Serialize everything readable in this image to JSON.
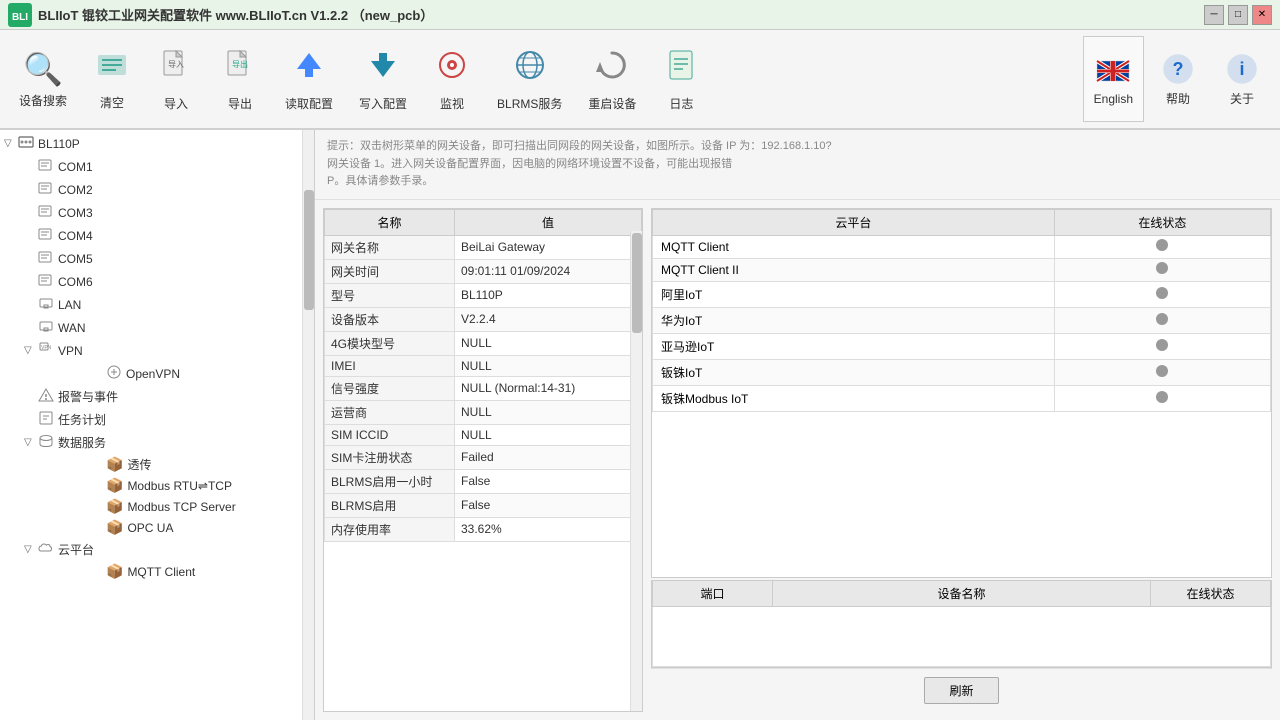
{
  "titlebar": {
    "title": "BLIIoT 锟铰工业网关配置软件 www.BLIIoT.cn V1.2.2 （new_pcb）",
    "controls": [
      "minimize",
      "maximize",
      "close"
    ]
  },
  "toolbar": {
    "buttons": [
      {
        "id": "search",
        "icon": "🔍",
        "label": "设备搜索"
      },
      {
        "id": "clear",
        "icon": "🧹",
        "label": "清空"
      },
      {
        "id": "import",
        "icon": "📥",
        "label": "导入"
      },
      {
        "id": "export",
        "icon": "📤",
        "label": "导出"
      },
      {
        "id": "read-config",
        "icon": "⬆️",
        "label": "读取配置"
      },
      {
        "id": "write-config",
        "icon": "⬇️",
        "label": "写入配置"
      },
      {
        "id": "monitor",
        "icon": "👁",
        "label": "监视"
      },
      {
        "id": "blrms",
        "icon": "🌐",
        "label": "BLRMS服务"
      },
      {
        "id": "restart",
        "icon": "⏻",
        "label": "重启设备"
      },
      {
        "id": "log",
        "icon": "📋",
        "label": "日志"
      }
    ],
    "english": "English",
    "help": "帮助",
    "about": "关于"
  },
  "sidebar": {
    "tree": [
      {
        "id": "bl110p",
        "label": "BL110P",
        "icon": "🖧",
        "expanded": true,
        "level": 0,
        "hasToggle": true
      },
      {
        "id": "com1",
        "label": "COM1",
        "icon": "⌨",
        "level": 1
      },
      {
        "id": "com2",
        "label": "COM2",
        "icon": "⌨",
        "level": 1
      },
      {
        "id": "com3",
        "label": "COM3",
        "icon": "⌨",
        "level": 1
      },
      {
        "id": "com4",
        "label": "COM4",
        "icon": "⌨",
        "level": 1
      },
      {
        "id": "com5",
        "label": "COM5",
        "icon": "⌨",
        "level": 1
      },
      {
        "id": "com6",
        "label": "COM6",
        "icon": "⌨",
        "level": 1
      },
      {
        "id": "lan",
        "label": "LAN",
        "icon": "🖥",
        "level": 1
      },
      {
        "id": "wan",
        "label": "WAN",
        "icon": "🖥",
        "level": 1
      },
      {
        "id": "vpn",
        "label": "VPN",
        "icon": "🔒",
        "level": 1,
        "expanded": true,
        "hasToggle": true
      },
      {
        "id": "openvpn",
        "label": "OpenVPN",
        "icon": "🔑",
        "level": 2
      },
      {
        "id": "alert",
        "label": "报警与事件",
        "icon": "🔔",
        "level": 1
      },
      {
        "id": "task",
        "label": "任务计划",
        "icon": "📅",
        "level": 1
      },
      {
        "id": "dataservice",
        "label": "数据服务",
        "icon": "🗄",
        "level": 1,
        "expanded": true,
        "hasToggle": true
      },
      {
        "id": "transmit",
        "label": "透传",
        "icon": "📦",
        "level": 2
      },
      {
        "id": "modbus-rtu-tcp",
        "label": "Modbus RTU⇌TCP",
        "icon": "📦",
        "level": 2
      },
      {
        "id": "modbus-tcp-server",
        "label": "Modbus TCP Server",
        "icon": "📦",
        "level": 2
      },
      {
        "id": "opc-ua",
        "label": "OPC UA",
        "icon": "📦",
        "level": 2
      },
      {
        "id": "cloudplatform",
        "label": "云平台",
        "icon": "☁",
        "level": 1,
        "expanded": true,
        "hasToggle": true
      },
      {
        "id": "mqtt-client",
        "label": "MQTT Client",
        "icon": "📦",
        "level": 2
      }
    ]
  },
  "content": {
    "header_lines": [
      "提示：双击树形菜单的网关设备，即可扫描出同网段的网关设备，如图所示。设备 IP 为：192.168.1.10?",
      "网关设备 1。进入网关设备配置界面，因电脑的网络环境设置不设备，可能出现报错",
      "P。具体请参数手录。"
    ]
  },
  "info_table": {
    "headers": [
      "名称",
      "值"
    ],
    "rows": [
      {
        "name": "网关名称",
        "value": "BeiLai Gateway"
      },
      {
        "name": "网关时间",
        "value": "09:01:11 01/09/2024"
      },
      {
        "name": "型号",
        "value": "BL110P"
      },
      {
        "name": "设备版本",
        "value": "V2.2.4"
      },
      {
        "name": "4G模块型号",
        "value": "NULL"
      },
      {
        "name": "IMEI",
        "value": "NULL"
      },
      {
        "name": "信号强度",
        "value": "NULL (Normal:14-31)"
      },
      {
        "name": "运营商",
        "value": "NULL"
      },
      {
        "name": "SIM ICCID",
        "value": "NULL"
      },
      {
        "name": "SIM卡注册状态",
        "value": "Failed"
      },
      {
        "name": "BLRMS启用一小时",
        "value": "False"
      },
      {
        "name": "BLRMS启用",
        "value": "False"
      },
      {
        "name": "内存使用率",
        "value": "33.62%"
      }
    ]
  },
  "cloud_table": {
    "headers": [
      "云平台",
      "在线状态"
    ],
    "rows": [
      {
        "name": "MQTT Client",
        "online": false
      },
      {
        "name": "MQTT Client II",
        "online": false
      },
      {
        "name": "阿里IoT",
        "online": false
      },
      {
        "name": "华为IoT",
        "online": false
      },
      {
        "name": "亚马逊IoT",
        "online": false
      },
      {
        "name": "钣铢IoT",
        "online": false
      },
      {
        "name": "钣铢Modbus IoT",
        "online": false
      }
    ]
  },
  "device_table": {
    "headers": [
      "端口",
      "设备名称",
      "在线状态"
    ],
    "rows": []
  },
  "refresh_btn": "刷新"
}
